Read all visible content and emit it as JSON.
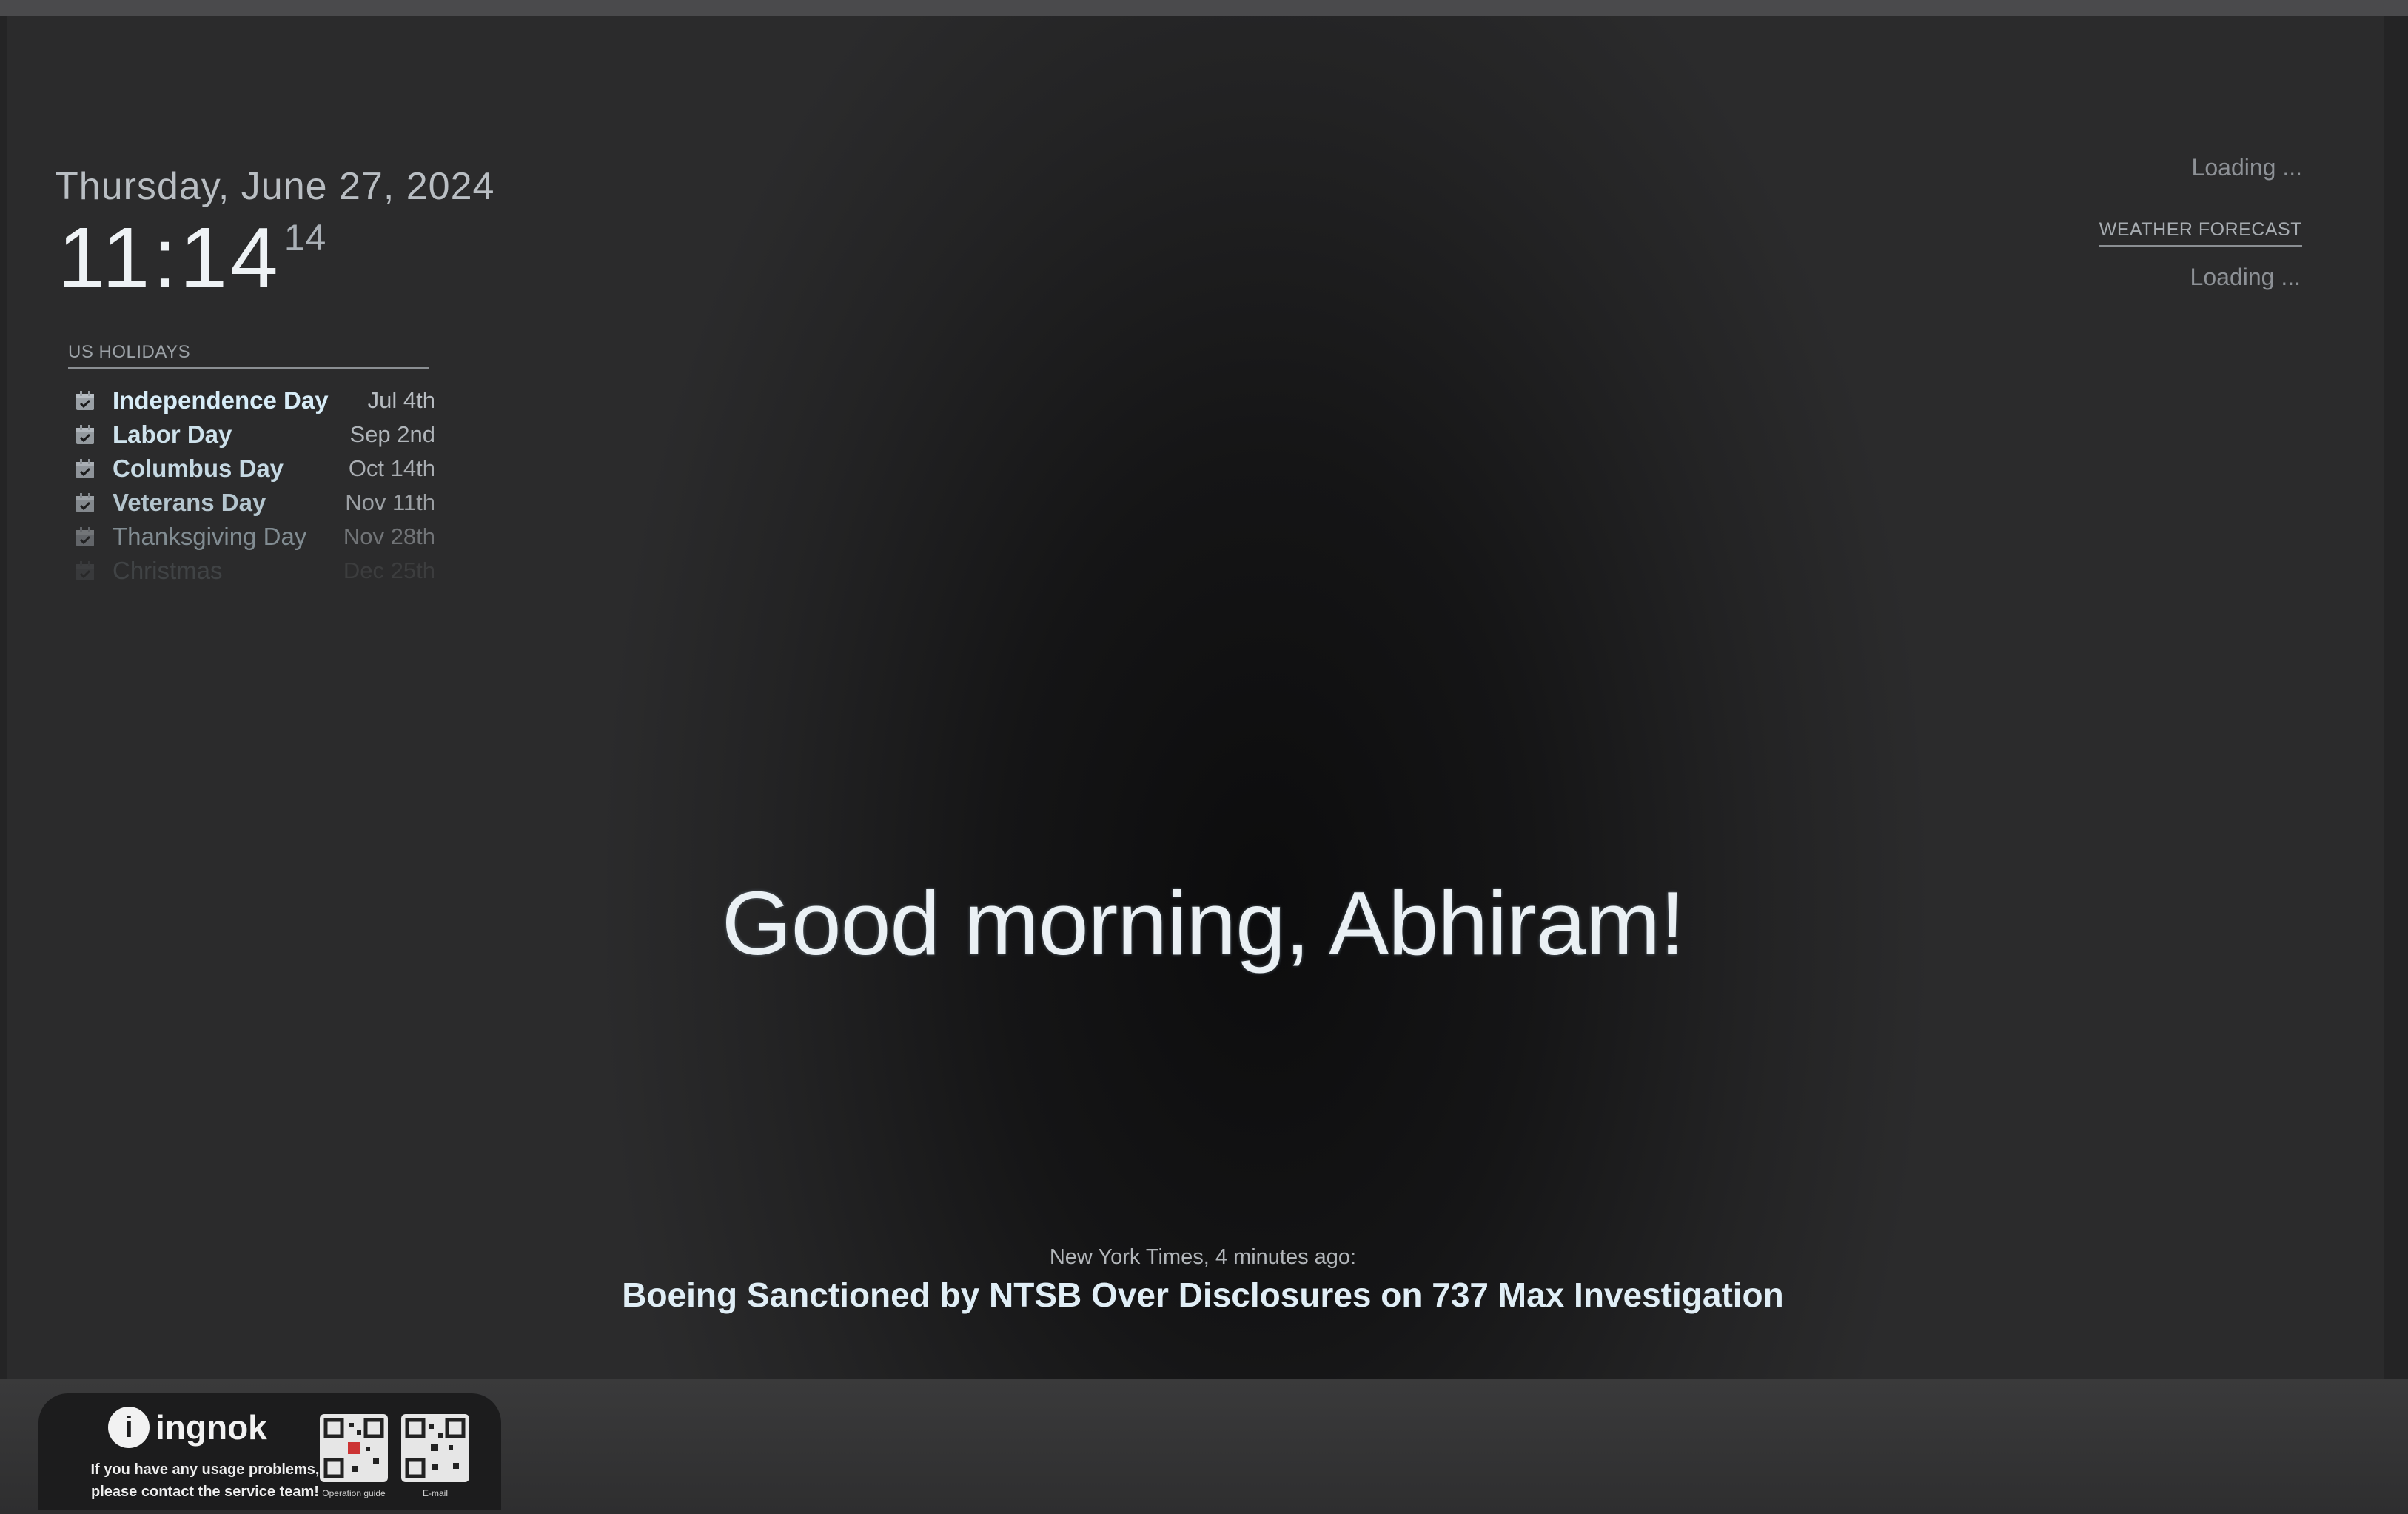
{
  "clock": {
    "date": "Thursday, June 27, 2024",
    "time": "11:14",
    "seconds": "14"
  },
  "holidays": {
    "header": "US HOLIDAYS",
    "items": [
      {
        "name": "Independence Day",
        "date": "Jul 4th",
        "opacity": 1.0
      },
      {
        "name": "Labor Day",
        "date": "Sep 2nd",
        "opacity": 0.95
      },
      {
        "name": "Columbus Day",
        "date": "Oct 14th",
        "opacity": 0.9
      },
      {
        "name": "Veterans Day",
        "date": "Nov 11th",
        "opacity": 0.8
      },
      {
        "name": "Thanksgiving Day",
        "date": "Nov 28th",
        "opacity": 0.5
      },
      {
        "name": "Christmas",
        "date": "Dec 25th",
        "opacity": 0.12
      }
    ],
    "icon": "calendar-check-icon"
  },
  "weather": {
    "current_loading": "Loading ...",
    "forecast_header": "WEATHER FORECAST",
    "forecast_loading": "Loading ..."
  },
  "compliments": {
    "greeting": "Good morning, Abhiram!"
  },
  "news": {
    "source": "New York Times, 4 minutes ago:",
    "headline": "Boeing Sanctioned by NTSB Over Disclosures on 737 Max Investigation"
  },
  "sticker": {
    "brand": "ingnok",
    "brand_mark": "i",
    "support_line1": "If you have any usage problems,",
    "support_line2": "please contact the service team!",
    "qr_labels": [
      "Operation guide",
      "E-mail"
    ]
  }
}
